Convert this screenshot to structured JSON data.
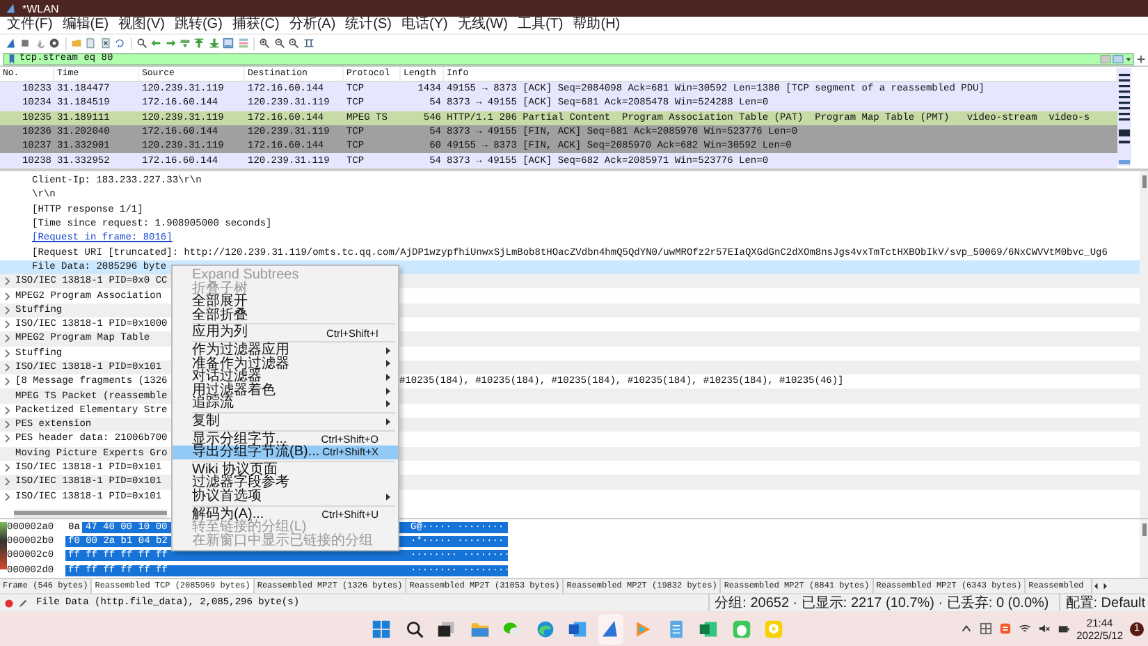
{
  "window": {
    "title": "*WLAN"
  },
  "menu": [
    "文件(F)",
    "编辑(E)",
    "视图(V)",
    "跳转(G)",
    "捕获(C)",
    "分析(A)",
    "统计(S)",
    "电话(Y)",
    "无线(W)",
    "工具(T)",
    "帮助(H)"
  ],
  "filter": {
    "value": "tcp.stream eq 80"
  },
  "packet_list": {
    "columns": [
      "No.",
      "Time",
      "Source",
      "Destination",
      "Protocol",
      "Length",
      "Info"
    ],
    "rows": [
      {
        "no": "10233",
        "time": "31.184477",
        "source": "120.239.31.119",
        "destination": "172.16.60.144",
        "protocol": "TCP",
        "length": "1434",
        "info": "49155 → 8373 [ACK] Seq=2084098 Ack=681 Win=30592 Len=1380 [TCP segment of a reassembled PDU]",
        "color": "#e7e6ff"
      },
      {
        "no": "10234",
        "time": "31.184519",
        "source": "172.16.60.144",
        "destination": "120.239.31.119",
        "protocol": "TCP",
        "length": "54",
        "info": "8373 → 49155 [ACK] Seq=681 Ack=2085478 Win=524288 Len=0",
        "color": "#e7e6ff"
      },
      {
        "no": "10235",
        "time": "31.189111",
        "source": "120.239.31.119",
        "destination": "172.16.60.144",
        "protocol": "MPEG TS",
        "length": "546",
        "info": "HTTP/1.1 206 Partial Content  Program Association Table (PAT)  Program Map Table (PMT)   video-stream  video-s",
        "color": "#c6dba6"
      },
      {
        "no": "10236",
        "time": "31.202040",
        "source": "172.16.60.144",
        "destination": "120.239.31.119",
        "protocol": "TCP",
        "length": "54",
        "info": "8373 → 49155 [FIN, ACK] Seq=681 Ack=2085970 Win=523776 Len=0",
        "color": "#a0a0a0"
      },
      {
        "no": "10237",
        "time": "31.332901",
        "source": "120.239.31.119",
        "destination": "172.16.60.144",
        "protocol": "TCP",
        "length": "60",
        "info": "49155 → 8373 [FIN, ACK] Seq=2085970 Ack=682 Win=30592 Len=0",
        "color": "#a0a0a0"
      },
      {
        "no": "10238",
        "time": "31.332952",
        "source": "172.16.60.144",
        "destination": "120.239.31.119",
        "protocol": "TCP",
        "length": "54",
        "info": "8373 → 49155 [ACK] Seq=682 Ack=2085971 Win=523776 Len=0",
        "color": "#e7e6ff"
      }
    ]
  },
  "details": {
    "continued_children": [
      {
        "text": "Client-Ip: 183.233.227.33\\r\\n",
        "link": false,
        "selected": false
      },
      {
        "text": "\\r\\n",
        "link": false,
        "selected": false
      },
      {
        "text": "[HTTP response 1/1]",
        "link": false,
        "selected": false
      },
      {
        "text": "[Time since request: 1.908905000 seconds]",
        "link": false,
        "selected": false
      },
      {
        "text": "[Request in frame: 8016]",
        "link": true,
        "selected": false
      },
      {
        "text": "[Request URI [truncated]: http://120.239.31.119/omts.tc.qq.com/AjDP1wzypfhiUnwxSjLmBob8tHOacZVdbn4hmQ5QdYN0/uwMROfz2r57EIaQXGdGnC2dXOm8nsJgs4vxTmTctHXBObIkV/svp_50069/6NxCWVVtM0bvc_Ug6",
        "link": false,
        "selected": false
      },
      {
        "text": "File Data: 2085296 byte",
        "link": false,
        "selected": true
      }
    ],
    "items": [
      {
        "text": "ISO/IEC 13818-1 PID=0x0 CC",
        "expandable": true,
        "selected": false
      },
      {
        "text": "MPEG2 Program Association",
        "expandable": true,
        "selected": false
      },
      {
        "text": "Stuffing",
        "expandable": true,
        "selected": false
      },
      {
        "text": "ISO/IEC 13818-1 PID=0x1000",
        "expandable": true,
        "selected": false
      },
      {
        "text": "MPEG2 Program Map Table",
        "expandable": true,
        "selected": false
      },
      {
        "text": "Stuffing",
        "expandable": true,
        "selected": false
      },
      {
        "text": "ISO/IEC 13818-1 PID=0x101",
        "expandable": true,
        "selected": false
      },
      {
        "text": "[8 Message fragments (1326",
        "tail": "#10235(184), #10235(184), #10235(184), #10235(184), #10235(184), #10235(46)]",
        "expandable": true,
        "selected": false
      },
      {
        "text": "MPEG TS Packet (reassemble",
        "expandable": false,
        "selected": false
      },
      {
        "text": "Packetized Elementary Stre",
        "expandable": true,
        "selected": false
      },
      {
        "text": "PES extension",
        "expandable": true,
        "selected": false
      },
      {
        "text": "PES header data: 21006b700",
        "expandable": true,
        "selected": false
      },
      {
        "text": "Moving Picture Experts Gro",
        "expandable": false,
        "selected": false
      },
      {
        "text": "ISO/IEC 13818-1 PID=0x101",
        "expandable": true,
        "selected": false
      },
      {
        "text": "ISO/IEC 13818-1 PID=0x101",
        "expandable": true,
        "selected": false
      },
      {
        "text": "ISO/IEC 13818-1 PID=0x101",
        "expandable": true,
        "selected": false
      }
    ]
  },
  "context_menu": [
    {
      "kind": "item",
      "label": "Expand Subtrees",
      "disabled": true,
      "submenu": false,
      "selected": false
    },
    {
      "kind": "item",
      "label": "折叠子树",
      "disabled": true,
      "submenu": false,
      "selected": false
    },
    {
      "kind": "item",
      "label": "全部展开",
      "disabled": false,
      "submenu": false,
      "selected": false
    },
    {
      "kind": "item",
      "label": "全部折叠",
      "disabled": false,
      "submenu": false,
      "selected": false
    },
    {
      "kind": "separator"
    },
    {
      "kind": "item",
      "label": "应用为列",
      "shortcut": "Ctrl+Shift+I",
      "disabled": false,
      "submenu": false,
      "selected": false
    },
    {
      "kind": "separator"
    },
    {
      "kind": "item",
      "label": "作为过滤器应用",
      "disabled": false,
      "submenu": true,
      "selected": false
    },
    {
      "kind": "item",
      "label": "准备作为过滤器",
      "disabled": false,
      "submenu": true,
      "selected": false
    },
    {
      "kind": "item",
      "label": "对话过滤器",
      "disabled": false,
      "submenu": true,
      "selected": false
    },
    {
      "kind": "item",
      "label": "用过滤器着色",
      "disabled": false,
      "submenu": true,
      "selected": false
    },
    {
      "kind": "item",
      "label": "追踪流",
      "disabled": false,
      "submenu": true,
      "selected": false
    },
    {
      "kind": "separator"
    },
    {
      "kind": "item",
      "label": "复制",
      "disabled": false,
      "submenu": true,
      "selected": false
    },
    {
      "kind": "separator"
    },
    {
      "kind": "item",
      "label": "显示分组字节...",
      "shortcut": "Ctrl+Shift+O",
      "disabled": false,
      "submenu": false,
      "selected": false
    },
    {
      "kind": "item",
      "label": "导出分组字节流(B)...",
      "shortcut": "Ctrl+Shift+X",
      "disabled": false,
      "submenu": false,
      "selected": true
    },
    {
      "kind": "separator"
    },
    {
      "kind": "item",
      "label": "Wiki 协议页面",
      "disabled": false,
      "submenu": false,
      "selected": false
    },
    {
      "kind": "item",
      "label": "过滤器字段参考",
      "disabled": false,
      "submenu": false,
      "selected": false
    },
    {
      "kind": "item",
      "label": "协议首选项",
      "disabled": false,
      "submenu": true,
      "selected": false
    },
    {
      "kind": "separator"
    },
    {
      "kind": "item",
      "label": "解码为(A)...",
      "shortcut": "Ctrl+Shift+U",
      "disabled": false,
      "submenu": false,
      "selected": false
    },
    {
      "kind": "item",
      "label": "转至链接的分组(L)",
      "disabled": true,
      "submenu": false,
      "selected": false
    },
    {
      "kind": "item",
      "label": "在新窗口中显示已链接的分组",
      "disabled": true,
      "submenu": false,
      "selected": false
    }
  ],
  "hex": [
    {
      "offset": "000002a0",
      "hex": [
        {
          "text": "0a",
          "selected": false
        },
        {
          "text": "47 40 00 10 00",
          "selected": true
        }
      ],
      "ascii": "G@····· ········"
    },
    {
      "offset": "000002b0",
      "hex": [
        {
          "text": "f0 00 2a b1 04 b2",
          "selected": true
        }
      ],
      "ascii": "·*····· ········"
    },
    {
      "offset": "000002c0",
      "hex": [
        {
          "text": "ff ff ff ff ff ff",
          "selected": true
        }
      ],
      "ascii": "········ ········"
    },
    {
      "offset": "000002d0",
      "hex": [
        {
          "text": "ff ff ff ff ff ff",
          "selected": true
        }
      ],
      "ascii": "········ ········"
    }
  ],
  "byte_tabs": [
    {
      "label": "Frame (546 bytes)",
      "selected": false
    },
    {
      "label": "Reassembled TCP (2085969 bytes)",
      "selected": true
    },
    {
      "label": "Reassembled MP2T (1326 bytes)",
      "selected": false
    },
    {
      "label": "Reassembled MP2T (31053 bytes)",
      "selected": false
    },
    {
      "label": "Reassembled MP2T (19832 bytes)",
      "selected": false
    },
    {
      "label": "Reassembled MP2T (8841 bytes)",
      "selected": false
    },
    {
      "label": "Reassembled MP2T (6343 bytes)",
      "selected": false
    },
    {
      "label": "Reassembled ",
      "selected": false
    }
  ],
  "status_bar": {
    "field": "File Data (http.file_data), 2,085,296 byte(s)",
    "stats": "分组: 20652 · 已显示: 2217 (10.7%) · 已丢弃: 0 (0.0%)",
    "profile": "配置: Default"
  },
  "taskbar": {
    "time": "21:44",
    "date": "2022/5/12",
    "notifications": "1"
  }
}
